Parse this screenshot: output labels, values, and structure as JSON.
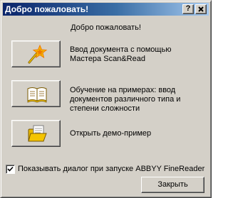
{
  "window": {
    "title": "Добро пожаловать!",
    "help_button": "?",
    "close_button": "X"
  },
  "greeting": "Добро пожаловать!",
  "options": [
    {
      "icon": "magic-wand-icon",
      "lines": [
        "Ввод документа с помощью",
        "Мастера Scan&Read"
      ]
    },
    {
      "icon": "open-book-icon",
      "lines": [
        "Обучение на примерах: ввод",
        "документов различного типа и",
        "степени сложности"
      ]
    },
    {
      "icon": "open-folder-icon",
      "lines": [
        "Открыть демо-пример"
      ]
    }
  ],
  "show_dialog_checkbox": {
    "checked": true,
    "label": "Показывать диалог при запуске ABBYY FineReader"
  },
  "close_label": "Закрыть",
  "colors": {
    "titlebar_start": "#0a246a",
    "titlebar_end": "#a6caf0",
    "face": "#d4d0c8",
    "icon_yellow": "#f4c400",
    "icon_orange": "#f07800"
  }
}
